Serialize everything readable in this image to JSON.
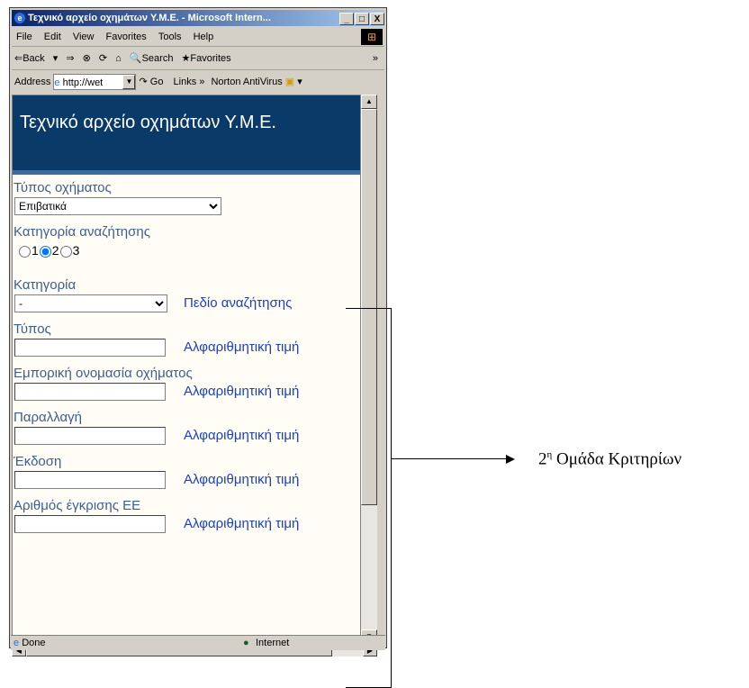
{
  "window": {
    "title": "Τεχνικό αρχείο οχημάτων Y.M.E. - Microsoft Intern...",
    "buttons": [
      "_",
      "□",
      "X"
    ]
  },
  "menu": [
    "File",
    "Edit",
    "View",
    "Favorites",
    "Tools",
    "Help"
  ],
  "toolbar": {
    "back": "⇐Back",
    "search": "Search",
    "favorites": "Favorites",
    "more": "»"
  },
  "address_bar": {
    "label": "Address",
    "value": "http://wet",
    "go": "Go",
    "links": "Links »",
    "norton": "Norton AntiVirus"
  },
  "page": {
    "header": "Τεχνικό αρχείο οχημάτων Υ.Μ.Ε.",
    "vehicle_type_label": "Τύπος οχήματος",
    "vehicle_type_value": "Επιβατικά",
    "search_category_label": "Κατηγορία αναζήτησης",
    "radio_options": [
      "1",
      "2",
      "3"
    ],
    "radio_selected": "2",
    "category_label": "Κατηγορία",
    "category_value": "-",
    "category_hint": "Πεδίο αναζήτησης",
    "fields": [
      {
        "label": "Τύπος",
        "hint": "Αλφαριθμητική τιμή"
      },
      {
        "label": "Εμπορική ονομασία οχήματος",
        "hint": "Αλφαριθμητική τιμή"
      },
      {
        "label": "Παραλλαγή",
        "hint": "Αλφαριθμητική τιμή"
      },
      {
        "label": "Έκδοση",
        "hint": "Αλφαριθμητική τιμή"
      },
      {
        "label": "Αριθμός έγκρισης ΕΕ",
        "hint": "Αλφαριθμητική τιμή"
      }
    ]
  },
  "status": {
    "left": "Done",
    "zone": "Internet"
  },
  "annotation": {
    "number": "2",
    "superscript": "η",
    "text": "Ομάδα Κριτηρίων"
  }
}
